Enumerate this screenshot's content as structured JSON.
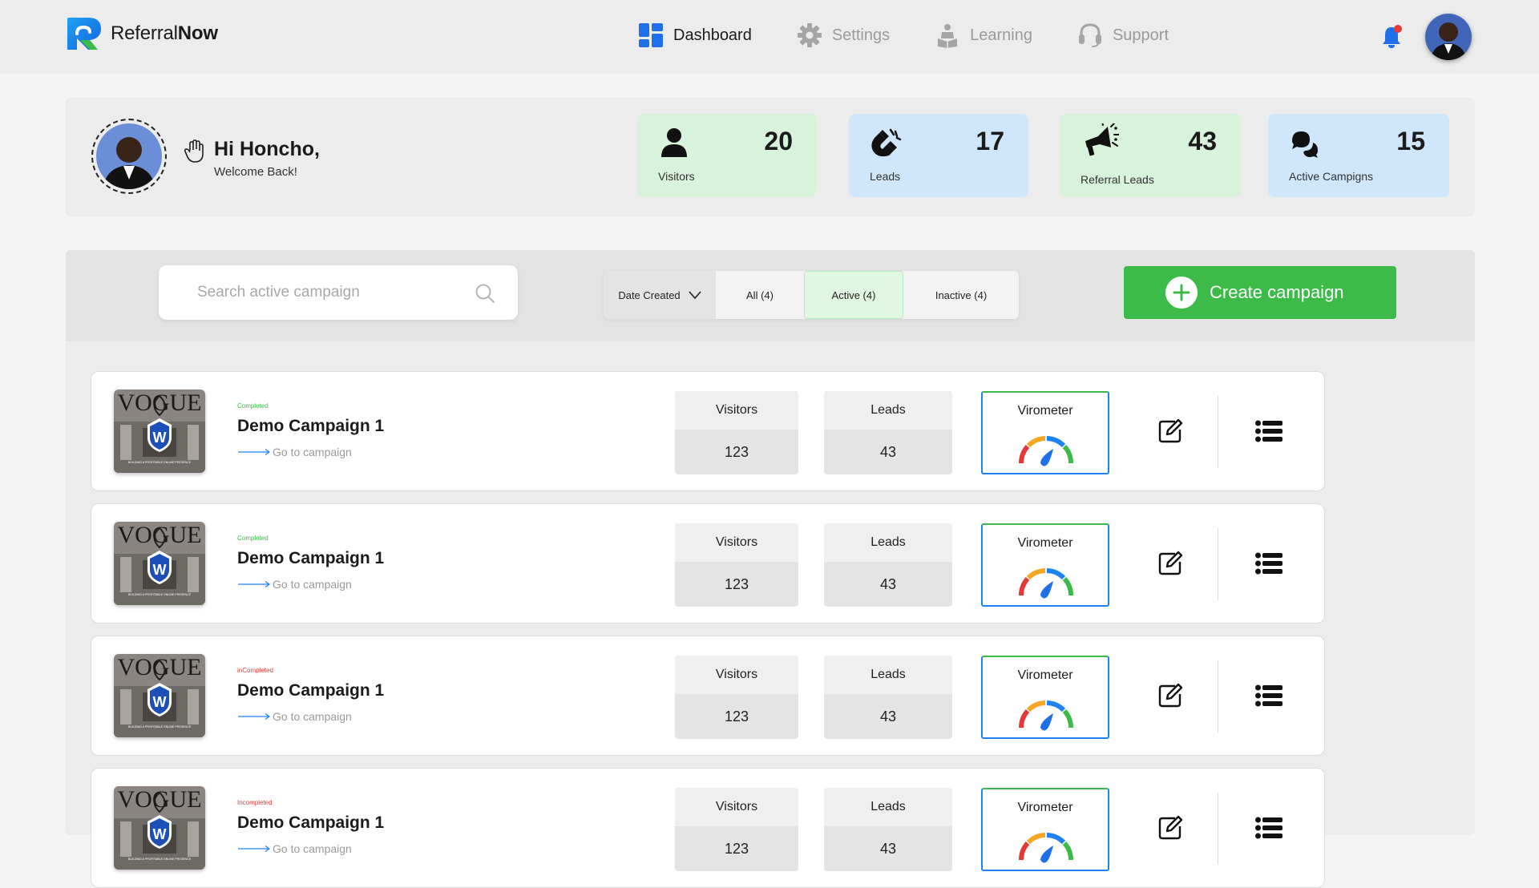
{
  "app": {
    "brand_prefix": "Referral",
    "brand_bold": "Now"
  },
  "nav": [
    {
      "label": "Dashboard",
      "icon": "grid-icon",
      "active": true
    },
    {
      "label": "Settings",
      "icon": "gear-icon",
      "active": false
    },
    {
      "label": "Learning",
      "icon": "learning-icon",
      "active": false
    },
    {
      "label": "Support",
      "icon": "headset-icon",
      "active": false
    }
  ],
  "notifications": {
    "has_unread": true
  },
  "greeting": {
    "title": "Hi Honcho,",
    "subtitle": "Welcome Back!"
  },
  "stats": [
    {
      "label": "Visitors",
      "value": "20",
      "icon": "person-icon",
      "color": "#d9f2dc"
    },
    {
      "label": "Leads",
      "value": "17",
      "icon": "magnet-icon",
      "color": "#cfe6fb"
    },
    {
      "label": "Referral Leads",
      "value": "43",
      "icon": "megaphone-icon",
      "color": "#d9f2dc"
    },
    {
      "label": "Active Campigns",
      "value": "15",
      "icon": "chat-bubbles-icon",
      "color": "#cfe6fb"
    }
  ],
  "search": {
    "placeholder": "Search active campaign",
    "value": ""
  },
  "filters": {
    "sort_label": "Date Created",
    "tabs": [
      {
        "label": "All (4)",
        "active": false
      },
      {
        "label": "Active (4)",
        "active": true
      },
      {
        "label": "Inactive (4)",
        "active": false
      }
    ]
  },
  "create_button": {
    "label": "Create campaign",
    "color": "#3dbb48"
  },
  "campaigns": [
    {
      "status": "Completed",
      "status_color": "#3dbb48",
      "name": "Demo Campaign 1",
      "link": "Go to campaign",
      "visitors_label": "Visitors",
      "visitors": "123",
      "leads_label": "Leads",
      "leads": "43",
      "meter_label": "Virometer"
    },
    {
      "status": "Completed",
      "status_color": "#3dbb48",
      "name": "Demo Campaign 1",
      "link": "Go to campaign",
      "visitors_label": "Visitors",
      "visitors": "123",
      "leads_label": "Leads",
      "leads": "43",
      "meter_label": "Virometer"
    },
    {
      "status": "inCompleted",
      "status_color": "#e53935",
      "name": "Demo Campaign 1",
      "link": "Go to campaign",
      "visitors_label": "Visitors",
      "visitors": "123",
      "leads_label": "Leads",
      "leads": "43",
      "meter_label": "Virometer"
    },
    {
      "status": "Incompleted",
      "status_color": "#e53935",
      "name": "Demo Campaign 1",
      "link": "Go to campaign",
      "visitors_label": "Visitors",
      "visitors": "123",
      "leads_label": "Leads",
      "leads": "43",
      "meter_label": "Virometer"
    }
  ],
  "thumbnail": {
    "masthead": "VOGUE",
    "badge": "W",
    "caption": "BUILDING A PROFITABLE ONLINE PRESENCE"
  }
}
